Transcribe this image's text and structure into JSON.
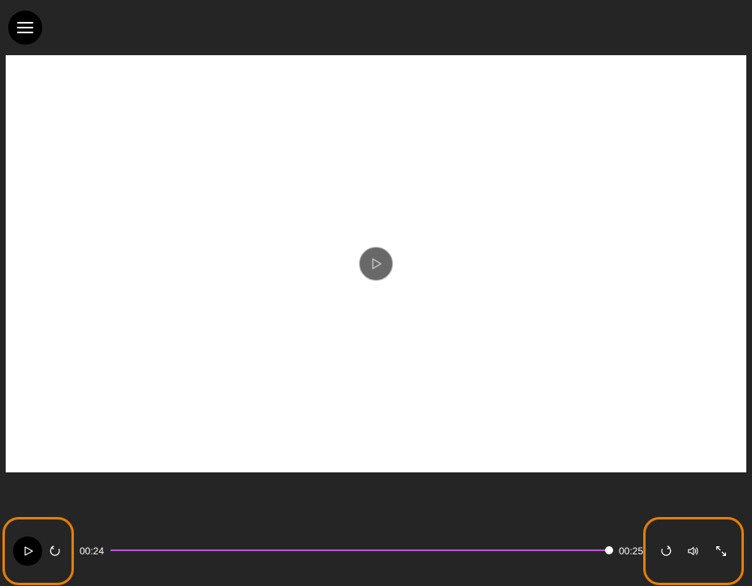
{
  "player": {
    "current_time": "00:24",
    "total_time": "00:25",
    "progress_percent": 96,
    "colors": {
      "accent": "#ba55d3",
      "highlight_border": "#e67e00"
    }
  }
}
